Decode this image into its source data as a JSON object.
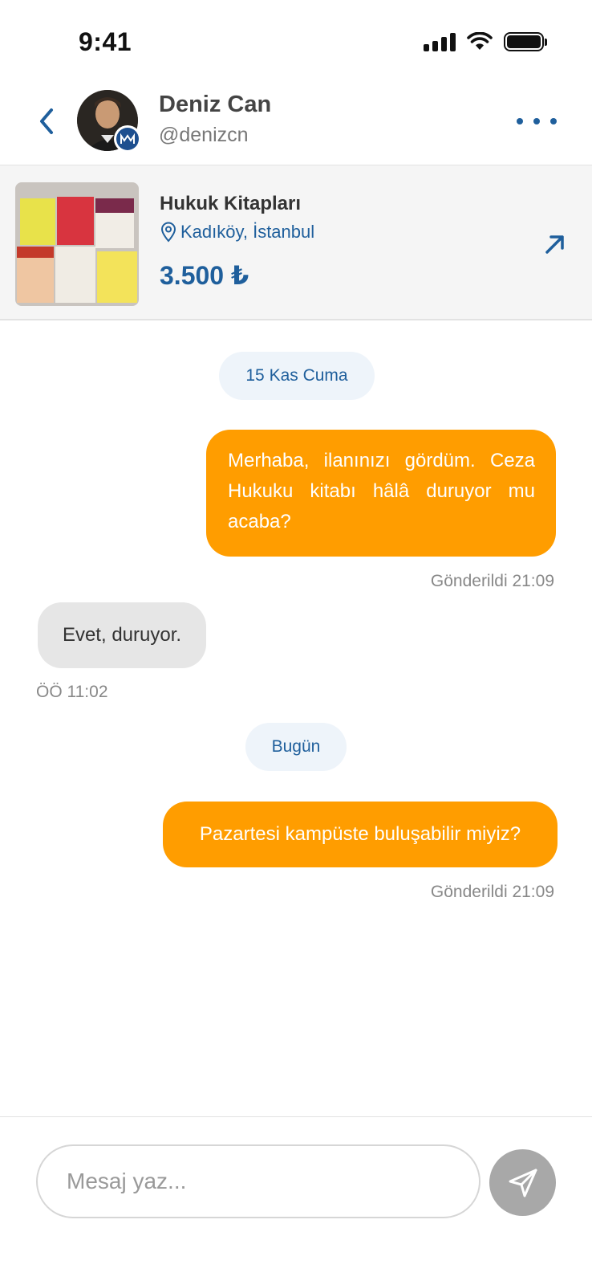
{
  "status_bar": {
    "time": "9:41"
  },
  "header": {
    "name": "Deniz Can",
    "handle": "@denizcn"
  },
  "listing": {
    "title": "Hukuk Kitapları",
    "location": "Kadıköy, İstanbul",
    "price": "3.500 ₺"
  },
  "chat": {
    "date_1": "15 Kas Cuma",
    "msg_1": "Merhaba, ilanınızı gördüm. Ceza Hukuku kitabı hâlâ duruyor mu acaba?",
    "msg_1_meta": "Gönderildi 21:09",
    "msg_2": "Evet, duruyor.",
    "msg_2_meta": "ÖÖ 11:02",
    "date_2": "Bugün",
    "msg_3": "Pazartesi kampüste buluşabilir miyiz?",
    "msg_3_meta": "Gönderildi 21:09"
  },
  "composer": {
    "placeholder": "Mesaj yaz..."
  },
  "colors": {
    "primary_blue": "#1f5f9c",
    "outgoing_bubble": "#ff9d00",
    "incoming_bubble": "#e6e6e6",
    "send_button": "#a8a8a8"
  }
}
